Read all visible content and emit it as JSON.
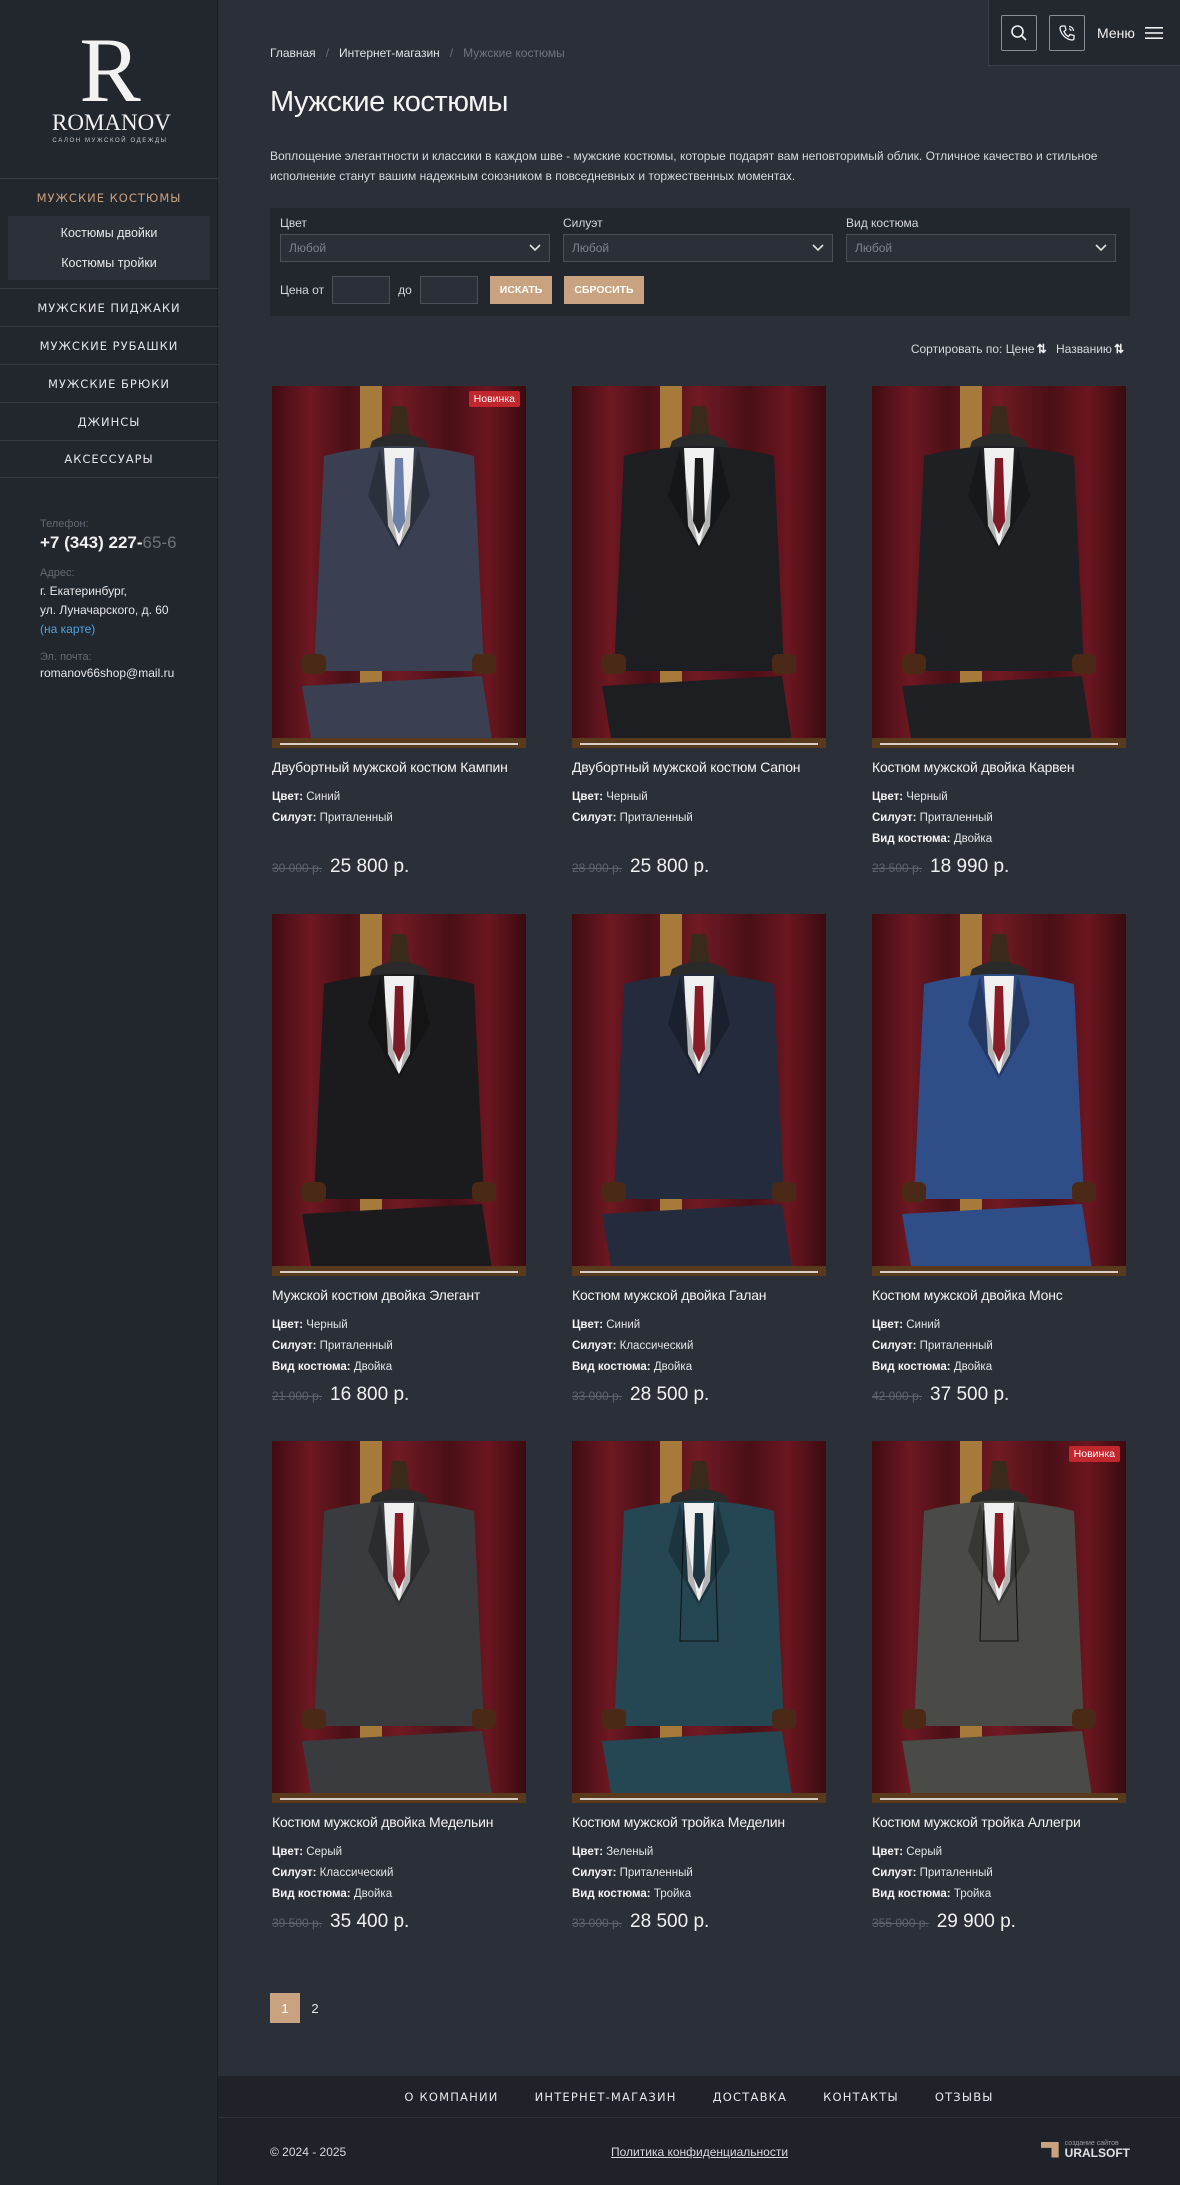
{
  "brand": {
    "initial": "R",
    "name": "ROMANOV",
    "tagline": "САЛОН МУЖСКОЙ ОДЕЖДЫ"
  },
  "sidebar": {
    "active": "МУЖСКИЕ КОСТЮМЫ",
    "sub": [
      "Костюмы двойки",
      "Костюмы тройки"
    ],
    "items": [
      "МУЖСКИЕ ПИДЖАКИ",
      "МУЖСКИЕ РУБАШКИ",
      "МУЖСКИЕ БРЮКИ",
      "ДЖИНСЫ",
      "АКСЕССУАРЫ"
    ],
    "contacts": {
      "phone_label": "Телефон:",
      "phone_main": "+7 (343) 227-",
      "phone_fade": "65-6",
      "address_label": "Адрес:",
      "address_line1": "г. Екатеринбург,",
      "address_line2": "ул. Луначарского, д. 60",
      "map_link": "(на карте)",
      "email_label": "Эл. почта:",
      "email": "romanov66shop@mail.ru"
    }
  },
  "header": {
    "menu_label": "Меню",
    "search_icon": "search-icon",
    "phone_icon": "phone-icon",
    "menu_icon": "hamburger-icon"
  },
  "breadcrumb": [
    "Главная",
    "Интернет-магазин",
    "Мужские костюмы"
  ],
  "page": {
    "title": "Мужские костюмы",
    "intro": "Воплощение элегантности и классики в каждом шве - мужские костюмы, которые подарят вам неповторимый облик. Отличное качество и стильное исполнение станут вашим надежным союзником в повседневных и торжественных моментах."
  },
  "filters": {
    "color_label": "Цвет",
    "color_value": "Любой",
    "silhouette_label": "Силуэт",
    "silhouette_value": "Любой",
    "type_label": "Вид костюма",
    "type_value": "Любой",
    "price_from": "Цена от",
    "price_to": "до",
    "search_btn": "ИСКАТЬ",
    "reset_btn": "СБРОСИТЬ"
  },
  "sort": {
    "label": "Сортировать по:",
    "by_price": "Цене",
    "by_name": "Названию"
  },
  "labels": {
    "color": "Цвет:",
    "silhouette": "Силуэт:",
    "type": "Вид костюма:"
  },
  "products": [
    {
      "name": "Двубортный мужской костюм Кампин",
      "color": "Синий",
      "silhouette": "Приталенный",
      "type": "",
      "old": "30 000 р.",
      "price": "25 800 р.",
      "badge": "Новинка",
      "suit": "#3a4052",
      "tie": "#6b7ea8",
      "pants": "#3a4052"
    },
    {
      "name": "Двубортный мужской костюм Сапон",
      "color": "Черный",
      "silhouette": "Приталенный",
      "type": "",
      "old": "28 900 р.",
      "price": "25 800 р.",
      "badge": "",
      "suit": "#1d1e21",
      "tie": "#1a1a1a",
      "pants": "#1d1e21"
    },
    {
      "name": "Костюм мужской двойка Карвен",
      "color": "Черный",
      "silhouette": "Приталенный",
      "type": "Двойка",
      "old": "23 500 р.",
      "price": "18 990 р.",
      "badge": "",
      "suit": "#1f2023",
      "tie": "#7d1a26",
      "pants": "#1f2023"
    },
    {
      "name": "Мужской костюм двойка Элегант",
      "color": "Черный",
      "silhouette": "Приталенный",
      "type": "Двойка",
      "old": "21 000 р.",
      "price": "16 800 р.",
      "badge": "",
      "suit": "#1b1b1d",
      "tie": "#7d1a26",
      "pants": "#1b1b1d"
    },
    {
      "name": "Костюм мужской двойка Галан",
      "color": "Синий",
      "silhouette": "Классический",
      "type": "Двойка",
      "old": "33 000 р.",
      "price": "28 500 р.",
      "badge": "",
      "suit": "#232b3d",
      "tie": "#8a1c28",
      "pants": "#232b3d"
    },
    {
      "name": "Костюм мужской двойка Монс",
      "color": "Синий",
      "silhouette": "Приталенный",
      "type": "Двойка",
      "old": "42 000 р.",
      "price": "37 500 р.",
      "badge": "",
      "suit": "#2f4d86",
      "tie": "#8a1c28",
      "pants": "#2f4d86"
    },
    {
      "name": "Костюм мужской двойка Медельин",
      "color": "Серый",
      "silhouette": "Классический",
      "type": "Двойка",
      "old": "39 500 р.",
      "price": "35 400 р.",
      "badge": "",
      "suit": "#3a3b3e",
      "tie": "#8a1c28",
      "pants": "#3a3b3e"
    },
    {
      "name": "Костюм мужской тройка Меделин",
      "color": "Зеленый",
      "silhouette": "Приталенный",
      "type": "Тройка",
      "old": "33 000 р.",
      "price": "28 500 р.",
      "badge": "",
      "suit": "#254653",
      "tie": "#1e3340",
      "pants": "#254653"
    },
    {
      "name": "Костюм мужской тройка Аллегри",
      "color": "Серый",
      "silhouette": "Приталенный",
      "type": "Тройка",
      "old": "355 000 р.",
      "price": "29 900 р.",
      "badge": "Новинка",
      "suit": "#4a4a46",
      "tie": "#8a1c28",
      "pants": "#4a4a46"
    }
  ],
  "pager": [
    "1",
    "2"
  ],
  "footer": {
    "nav": [
      "О КОМПАНИИ",
      "ИНТЕРНЕТ-МАГАЗИН",
      "ДОСТАВКА",
      "КОНТАКТЫ",
      "ОТЗЫВЫ"
    ],
    "copyright": "© 2024 - 2025",
    "policy": "Политика конфиденциальности",
    "dev_small": "создание сайтов",
    "dev_name": "URALSOFT"
  }
}
